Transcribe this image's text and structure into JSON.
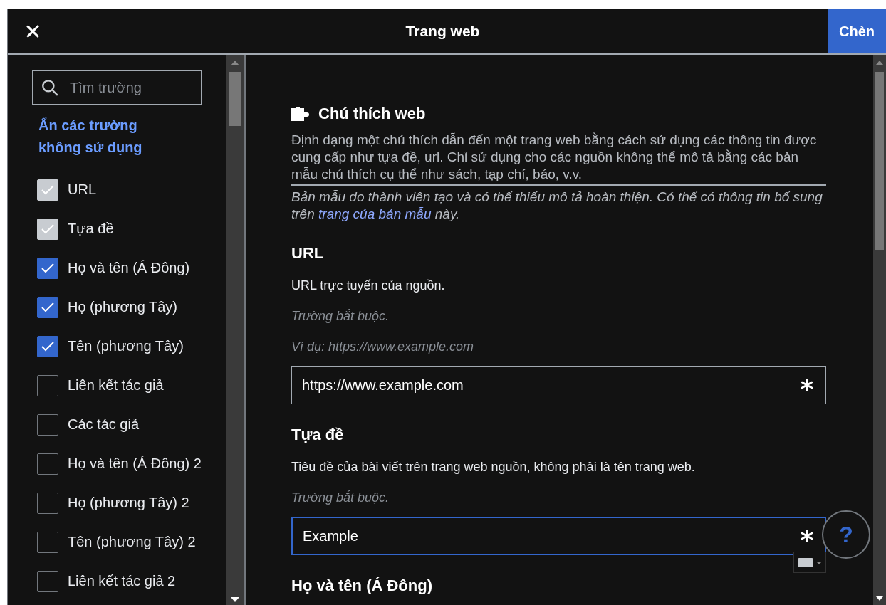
{
  "dialog": {
    "title": "Trang web",
    "close_label": "✕",
    "action": "Chèn"
  },
  "sidebar": {
    "search": {
      "placeholder": "Tìm trường"
    },
    "toggle_link": "Ẩn các trường không sử dụng",
    "fields": [
      {
        "label": "URL",
        "checked": true,
        "disabled": true
      },
      {
        "label": "Tựa đề",
        "checked": true,
        "disabled": true
      },
      {
        "label": "Họ và tên (Á Đông)",
        "checked": true,
        "disabled": false
      },
      {
        "label": "Họ (phương Tây)",
        "checked": true,
        "disabled": false
      },
      {
        "label": "Tên (phương Tây)",
        "checked": true,
        "disabled": false
      },
      {
        "label": "Liên kết tác giả",
        "checked": false,
        "disabled": false
      },
      {
        "label": "Các tác giả",
        "checked": false,
        "disabled": false
      },
      {
        "label": "Họ và tên (Á Đông) 2",
        "checked": false,
        "disabled": false
      },
      {
        "label": "Họ (phương Tây) 2",
        "checked": false,
        "disabled": false
      },
      {
        "label": "Tên (phương Tây) 2",
        "checked": false,
        "disabled": false
      },
      {
        "label": "Liên kết tác giả 2",
        "checked": false,
        "disabled": false
      }
    ]
  },
  "template": {
    "title": "Chú thích web",
    "description": "Định dạng một chú thích dẫn đến một trang web bằng cách sử dụng các thông tin được cung cấp như tựa đề, url. Chỉ sử dụng cho các nguồn không thể mô tả bằng các bản mẫu chú thích cụ thể như sách, tạp chí, báo, v.v.",
    "note_before": "Bản mẫu do thành viên tạo và có thể thiếu mô tả hoàn thiện. Có thể có thông tin bổ sung trên ",
    "note_link": "trang của bản mẫu",
    "note_after": " này."
  },
  "params": [
    {
      "name": "URL",
      "description": "URL trực tuyến của nguồn.",
      "required_note": "Trường bắt buộc.",
      "example": "Ví dụ: https://www.example.com",
      "value": "https://www.example.com",
      "focused": false,
      "required": true
    },
    {
      "name": "Tựa đề",
      "description": "Tiêu đề của bài viết trên trang web nguồn, không phải là tên trang web.",
      "required_note": "Trường bắt buộc.",
      "value": "Example",
      "focused": true,
      "required": true
    },
    {
      "name": "Họ và tên (Á Đông)"
    }
  ],
  "help_button": "?"
}
